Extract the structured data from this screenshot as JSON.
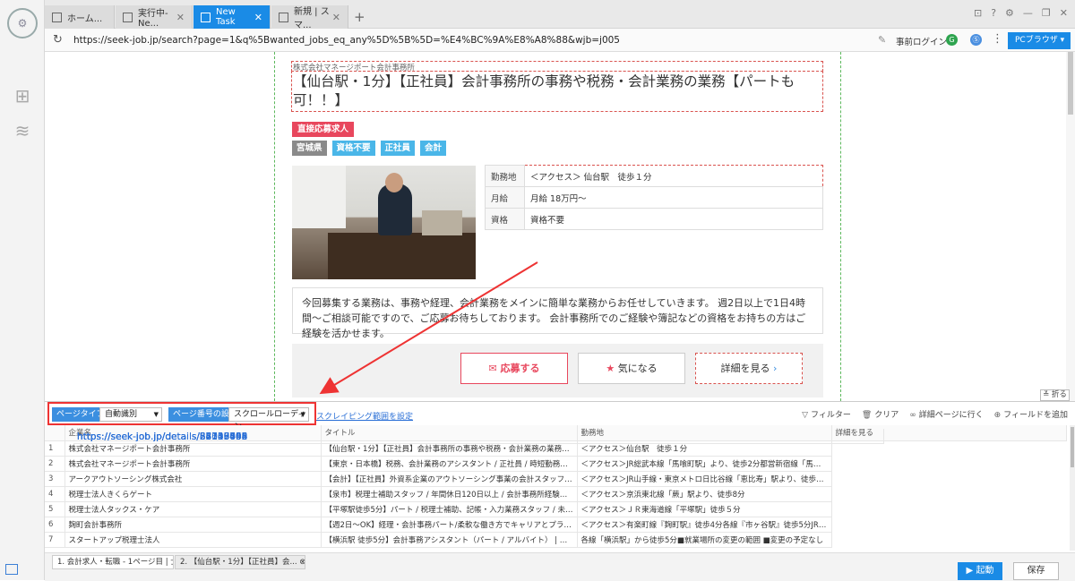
{
  "tabs": [
    {
      "label": "ホーム..."
    },
    {
      "label": "実行中-Ne..."
    },
    {
      "label": "New Task"
    },
    {
      "label": "新規 | スマ..."
    }
  ],
  "address": {
    "url": "https://seek-job.jp/search?page=1&q%5Bwanted_jobs_eq_any%5D%5B%5D=%E4%BC%9A%E8%A8%88&wjb=j005",
    "prelogin": "事前ログイン",
    "pc_browser": "PCブラウザ"
  },
  "job": {
    "company": "株式会社マネージポート会計事務所",
    "title": "【仙台駅・1分】【正社員】会計事務所の事務や税務・会計業務の業務【パートも可！！】",
    "badge": "直接応募求人",
    "tags": [
      "宮城県",
      "資格不要",
      "正社員",
      "会計"
    ],
    "details": [
      {
        "key": "勤務地",
        "value": "＜アクセス＞ 仙台駅　徒歩１分"
      },
      {
        "key": "月給",
        "value": "月給 18万円〜"
      },
      {
        "key": "資格",
        "value": "資格不要"
      }
    ],
    "description": "今回募集する業務は、事務や経理、会計業務をメインに簡単な業務からお任せしていきます。 週2日以上で1日4時間〜ご相談可能ですので、ご応募お待ちしております。 会計事務所でのご経験や簿記などの資格をお持ちの方はご経験を活かせます。",
    "apply": "応募する",
    "favorite": "気になる",
    "detail": "詳細を見る"
  },
  "fold_label": "折る",
  "toolbar": {
    "page_type_label": "ページタイプ",
    "page_type_value": "自動識別",
    "page_num_label": "ページ番号の設定",
    "page_num_value": "スクロールローディン",
    "scrape_link": "スクレイピング範囲を設定",
    "filter": "フィルター",
    "clear": "クリア",
    "goto_detail": "詳細ページに行く",
    "add_field": "フィールドを追加"
  },
  "grid": {
    "headers": [
      "",
      "企業名",
      "タイトル",
      "勤務地",
      "詳細を見る"
    ],
    "rows": [
      [
        "1",
        "株式会社マネージポート会計事務所",
        "【仙台駅・1分】【正社員】会計事務所の事務や税務・会計業務の業務【パート...",
        "＜アクセス＞仙台駅　徒歩１分",
        "https://seek-job.jp/details/58743665"
      ],
      [
        "2",
        "株式会社マネージポート会計事務所",
        "【東京・日本橋】税務、会計業務のアシスタント / 正社員 / 時短勤務やリモー...",
        "＜アクセス＞JR総武本線「馬喰町駅」より、徒歩2分都営新宿線「馬喰横山駅」...",
        "https://seek-job.jp/details/22103745"
      ],
      [
        "3",
        "アークアウトソーシング株式会社",
        "【会計】【正社員】外資系企業のアウトソーシング事業の会計スタッフ・シニ...",
        "＜アクセス＞JR山手線・東京メトロ日比谷線「恵比寿」駅より、徒歩5分※転勤...",
        "https://seek-job.jp/details/28119492"
      ],
      [
        "4",
        "税理士法人きくらゲート",
        "【泉市】税理士補助スタッフ / 年間休日120日以上 / 会計事務所経験者優遇",
        "＜アクセス＞京浜東北線「蕨」駅より、徒歩8分",
        "https://seek-job.jp/details/86336854"
      ],
      [
        "5",
        "税理士法人タックス・ケア",
        "【平塚駅徒歩5分】パート / 税理士補助、記帳・入力業務スタッフ / 未経験可",
        "＜アクセス＞ＪＲ東海道線「平塚駅」徒歩５分",
        "https://seek-job.jp/details/64038009"
      ],
      [
        "6",
        "麹町会計事務所",
        "【週2日〜OK】経理・会計事務パート/柔軟な働き方でキャリアとプライベート...",
        "＜アクセス＞有楽町線『麹町駅』徒歩4分各線『市ヶ谷駅』徒歩5分JR線『四ツ...",
        "https://seek-job.jp/details/34710466"
      ],
      [
        "7",
        "スタートアップ税理士法人",
        "【横浜駅 徒歩5分】会計事務アシスタント（パート / アルバイト） | 資格を活か...",
        "各線「横浜駅」から徒歩5分■就業場所の変更の範囲 ■変更の予定なし",
        "https://seek-job.jp/details/87137698"
      ]
    ]
  },
  "bottom_tabs": [
    {
      "label": "1. 会計求人・転職 - 1ページ目 | 士..."
    },
    {
      "label": "2. 【仙台駅・1分】【正社員】会..."
    }
  ],
  "run_label": "起動",
  "save_label": "保存"
}
